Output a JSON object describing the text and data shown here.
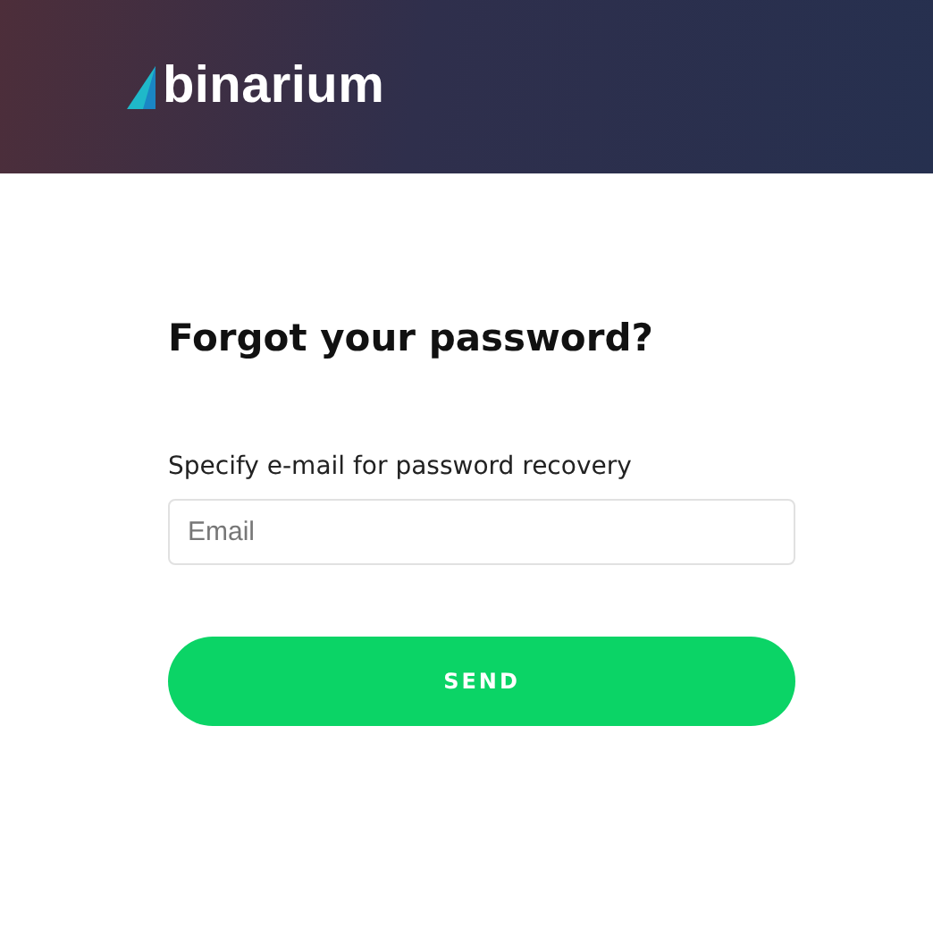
{
  "header": {
    "logo": "binarium"
  },
  "form": {
    "title": "Forgot your password?",
    "label": "Specify e-mail for password recovery",
    "email": {
      "placeholder": "Email"
    },
    "button": "SEND"
  }
}
